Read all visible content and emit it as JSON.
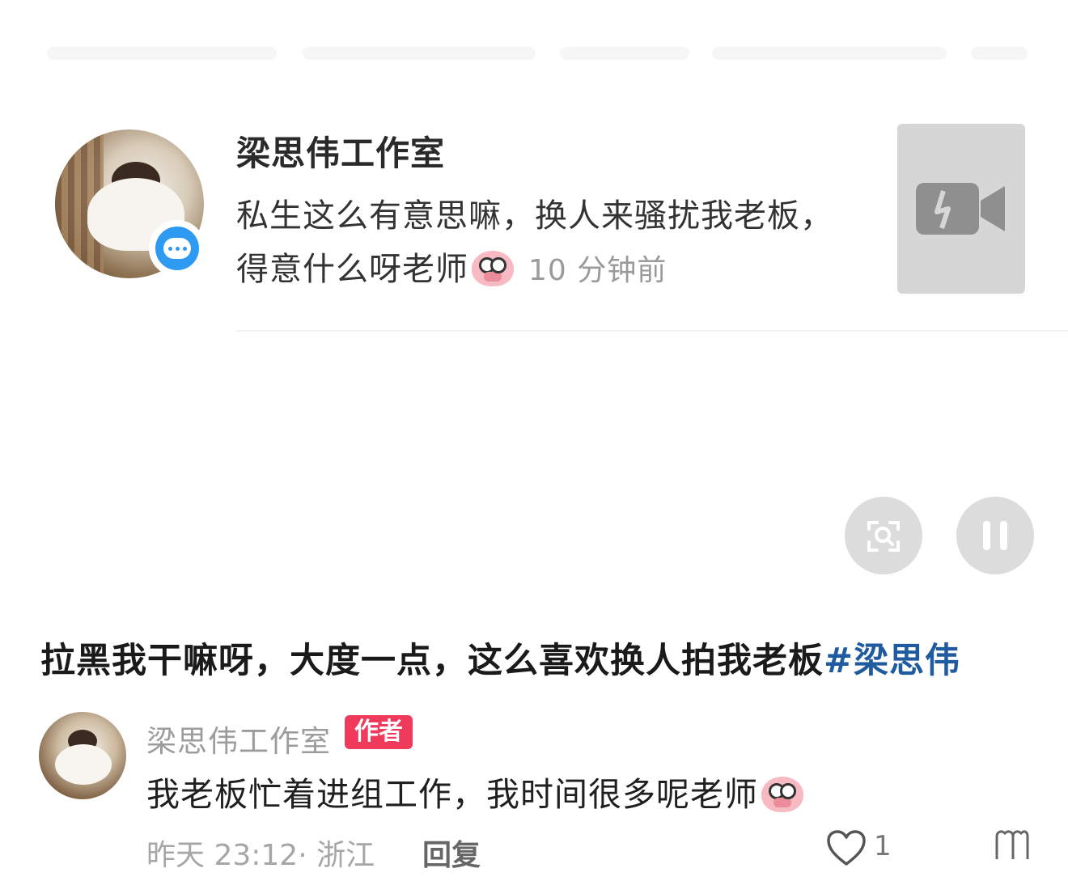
{
  "notice": {
    "name": "梁思伟工作室",
    "text": "私生这么有意思嘛，换人来骚扰我老板，得意什么呀老师",
    "time": "10 分钟前"
  },
  "post": {
    "caption": "拉黑我干嘛呀，大度一点，这么喜欢换人拍我老板",
    "hashtag": "#梁思伟"
  },
  "comment": {
    "author": "梁思伟工作室",
    "badge": "作者",
    "text": "我老板忙着进组工作，我时间很多呢老师",
    "meta": "昨天 23:12· 浙江",
    "reply": "回复",
    "likes": "1"
  },
  "icons": {
    "message": "message-bubble-icon",
    "video": "video-camera-icon",
    "search": "image-search-icon",
    "pause": "pause-icon",
    "like": "heart-icon",
    "emoji": "pig-face-emoji"
  },
  "colors": {
    "hashtag": "#1f5b9e",
    "badge": "#f03a5c",
    "message": "#2f9af2"
  }
}
